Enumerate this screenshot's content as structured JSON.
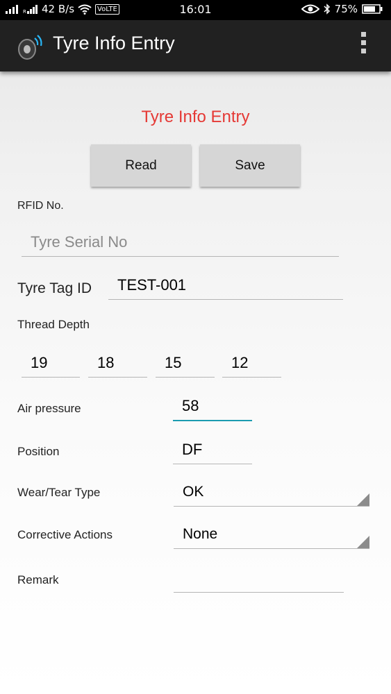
{
  "status_bar": {
    "data_rate": "42 B/s",
    "volte": "VoLTE",
    "time": "16:01",
    "battery": "75%",
    "icons": [
      "signal-icon",
      "signal-icon-2",
      "wifi-icon",
      "eye-icon",
      "bluetooth-icon",
      "battery-icon"
    ]
  },
  "app_bar": {
    "title": "Tyre Info Entry",
    "icon": "tyre-rfid-icon",
    "menu_icon": "overflow-menu-icon"
  },
  "form": {
    "title": "Tyre Info Entry",
    "title_color": "#e53935",
    "buttons": {
      "read": "Read",
      "save": "Save"
    },
    "rfid": {
      "label": "RFID No.",
      "placeholder": "Tyre Serial No",
      "value": ""
    },
    "tag": {
      "label": "Tyre Tag ID",
      "value": "TEST-001"
    },
    "thread_depth": {
      "label": "Thread Depth",
      "values": [
        "19",
        "18",
        "15",
        "12"
      ]
    },
    "air_pressure": {
      "label": "Air pressure",
      "value": "58",
      "focus_color": "#1b9bb0"
    },
    "position": {
      "label": "Position",
      "value": "DF"
    },
    "wear_tear": {
      "label": "Wear/Tear Type",
      "selected": "OK"
    },
    "corrective": {
      "label": "Corrective Actions",
      "selected": "None"
    },
    "remark": {
      "label": "Remark",
      "value": ""
    }
  }
}
